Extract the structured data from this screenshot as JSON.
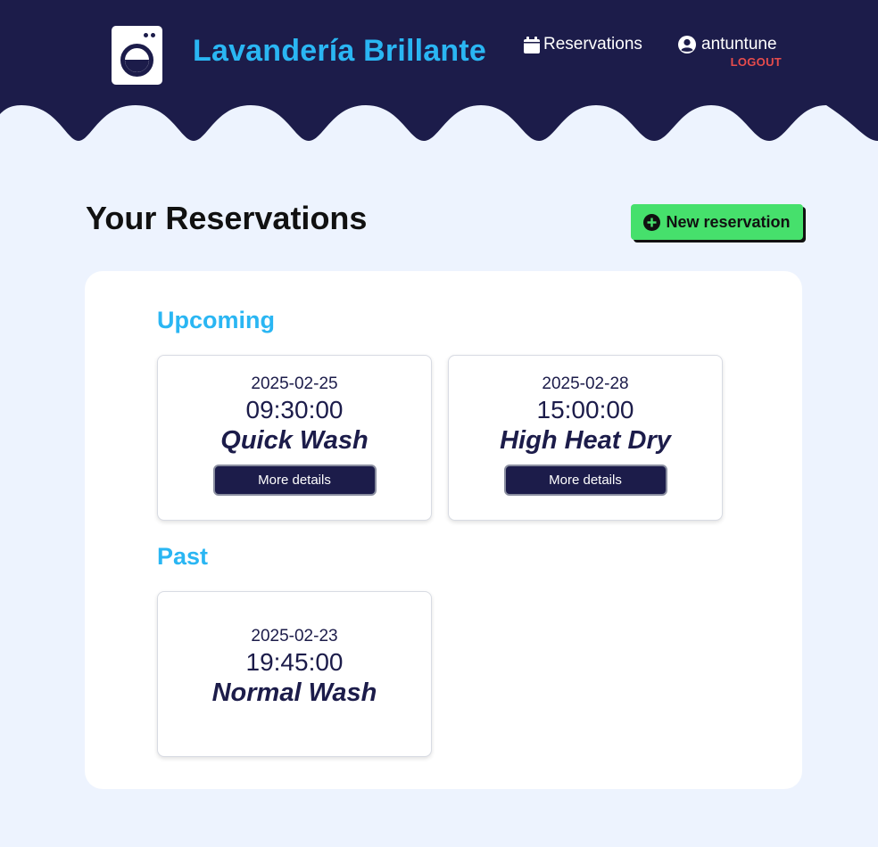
{
  "header": {
    "brand": "Lavandería Brillante",
    "nav_reservations": "Reservations",
    "username": "antuntune",
    "logout": "LOGOUT"
  },
  "icons": {
    "logo": "washing-machine-icon",
    "reservations": "calendar-icon",
    "user": "user-circle-icon",
    "new_reservation": "plus-circle-icon"
  },
  "page": {
    "title": "Your Reservations",
    "new_reservation_label": "New reservation"
  },
  "sections": {
    "upcoming_title": "Upcoming",
    "past_title": "Past"
  },
  "upcoming": [
    {
      "date": "2025-02-25",
      "time": "09:30:00",
      "service": "Quick Wash",
      "action": "More details"
    },
    {
      "date": "2025-02-28",
      "time": "15:00:00",
      "service": "High Heat Dry",
      "action": "More details"
    }
  ],
  "past": [
    {
      "date": "2025-02-23",
      "time": "19:45:00",
      "service": "Normal Wash"
    }
  ],
  "colors": {
    "navy": "#1c1c4a",
    "accent_blue": "#2ab6f3",
    "green": "#46e06c",
    "logout_red": "#e74c4c",
    "background": "#edf3fe"
  }
}
